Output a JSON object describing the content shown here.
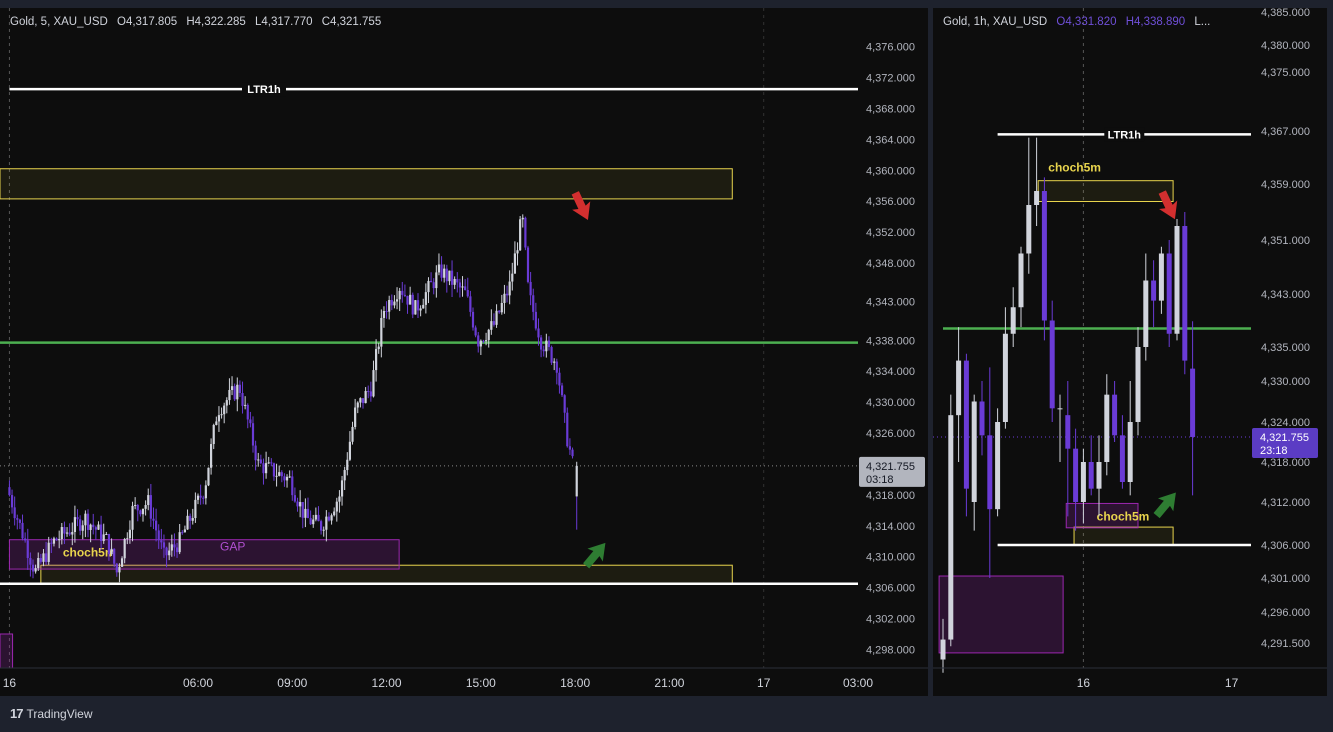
{
  "colors": {
    "background": "#0d0d0d",
    "up_candle": "#d1d4dc",
    "down_candle": "#6a3bd6",
    "level_green": "#4caf50",
    "level_white": "#ffffff",
    "zone_yellow": "#e8d44d",
    "zone_purple": "#9c27b0",
    "arrow_red": "#d32f2f",
    "arrow_green": "#2e7d32"
  },
  "footer": {
    "brand": "TradingView",
    "logo_glyph": "17"
  },
  "left_chart": {
    "legend": [
      "Gold, 5, XAU_USD",
      "O4,317.805",
      "H4,322.285",
      "L4,317.770",
      "C4,321.755"
    ],
    "price_label": "4,321.755",
    "countdown": "03:18",
    "annotations": {
      "ltr": "LTR1h",
      "choch": "choch5m",
      "gap": "GAP"
    }
  },
  "right_chart": {
    "legend": [
      "Gold, 1h, XAU_USD",
      "O4,331.820",
      "H4,338.890",
      "L..."
    ],
    "price_label": "4,321.755",
    "countdown": "23:18",
    "annotations": {
      "ltr": "LTR1h",
      "choch_top": "choch5m",
      "choch_bottom": "choch5m"
    }
  },
  "chart_data": [
    {
      "type": "candlestick",
      "title": "Gold, 5, XAU_USD",
      "ohlc_last": {
        "open": 4317.805,
        "high": 4322.285,
        "low": 4317.77,
        "close": 4321.755
      },
      "y_ticks": [
        "4,376.000",
        "4,372.000",
        "4,368.000",
        "4,364.000",
        "4,360.000",
        "4,356.000",
        "4,352.000",
        "4,348.000",
        "4,343.000",
        "4,338.000",
        "4,334.000",
        "4,330.000",
        "4,326.000",
        "4,318.000",
        "4,314.000",
        "4,310.000",
        "4,306.000",
        "4,302.000",
        "4,298.000"
      ],
      "y_tick_values": [
        4376,
        4372,
        4368,
        4364,
        4360,
        4356,
        4352,
        4348,
        4343,
        4338,
        4334,
        4330,
        4326,
        4318,
        4314,
        4310,
        4306,
        4302,
        4298
      ],
      "x_ticks": [
        "16",
        "06:00",
        "09:00",
        "12:00",
        "15:00",
        "18:00",
        "21:00",
        "17",
        "03:00"
      ],
      "x_tick_hours": [
        0,
        6,
        9,
        12,
        15,
        18,
        21,
        24,
        27
      ],
      "x_range_hours": [
        -0.3,
        27.0
      ],
      "ylim": [
        4295.6,
        4381.0
      ],
      "current_price": 4321.755,
      "levels": [
        {
          "name": "LTR1h",
          "price": 4370.5,
          "color": "white",
          "start_hour": 0
        },
        {
          "name": "",
          "price": 4337.7,
          "color": "green",
          "start_hour": -0.3
        },
        {
          "name": "",
          "price": 4306.5,
          "color": "white",
          "start_hour": -0.3
        }
      ],
      "zones": [
        {
          "label": "",
          "kind": "yellow",
          "t0": -0.3,
          "t1": 23.0,
          "p_top": 4360.2,
          "p_bot": 4356.3
        },
        {
          "label": "choch5m",
          "kind": "yellow",
          "t0": 1.0,
          "t1": 23.0,
          "p_top": 4308.9,
          "p_bot": 4306.5
        },
        {
          "label": "GAP",
          "kind": "purple",
          "t0": 0.0,
          "t1": 12.4,
          "p_top": 4312.2,
          "p_bot": 4308.4
        },
        {
          "label": "",
          "kind": "purple",
          "t0": -0.3,
          "t1": 0.1,
          "p_top": 4300.0,
          "p_bot": 4295.6
        }
      ],
      "arrows": [
        {
          "dir": "down",
          "color": "red",
          "t": 18.3,
          "p": 4354.5
        },
        {
          "dir": "up",
          "color": "green",
          "t": 18.8,
          "p": 4311.0
        }
      ],
      "path_keypoints": [
        [
          0,
          4319
        ],
        [
          0.5,
          4313
        ],
        [
          0.9,
          4308
        ],
        [
          1.5,
          4312
        ],
        [
          2.5,
          4315
        ],
        [
          3.2,
          4312
        ],
        [
          3.5,
          4308
        ],
        [
          4,
          4316
        ],
        [
          4.5,
          4317
        ],
        [
          5,
          4310
        ],
        [
          5.5,
          4312
        ],
        [
          6.3,
          4319
        ],
        [
          6.7,
          4329
        ],
        [
          7.4,
          4332
        ],
        [
          8,
          4322
        ],
        [
          9,
          4320
        ],
        [
          9.5,
          4315
        ],
        [
          10,
          4314
        ],
        [
          10.6,
          4318
        ],
        [
          11.1,
          4329
        ],
        [
          11.6,
          4332
        ],
        [
          12,
          4342
        ],
        [
          12.5,
          4345
        ],
        [
          13,
          4342
        ],
        [
          13.8,
          4347
        ],
        [
          14.6,
          4344
        ],
        [
          15,
          4338
        ],
        [
          15.5,
          4340
        ],
        [
          16,
          4345
        ],
        [
          16.4,
          4354
        ],
        [
          16.6,
          4344
        ],
        [
          17,
          4338
        ],
        [
          17.5,
          4335
        ],
        [
          17.8,
          4326
        ],
        [
          18,
          4322
        ]
      ],
      "up_color": "#d1d4dc",
      "down_color": "#6a3bd6"
    },
    {
      "type": "candlestick",
      "title": "Gold, 1h, XAU_USD",
      "ohlc_last": {
        "open": 4331.82,
        "high": 4338.89
      },
      "y_ticks": [
        "4,385.000",
        "4,380.000",
        "4,375.000",
        "4,367.000",
        "4,359.000",
        "4,351.000",
        "4,343.000",
        "4,335.000",
        "4,330.000",
        "4,324.000",
        "4,318.000",
        "4,312.000",
        "4,306.000",
        "4,301.000",
        "4,296.000",
        "4,291.500"
      ],
      "y_tick_values": [
        4385,
        4380,
        4375,
        4367,
        4359,
        4351,
        4343,
        4335,
        4330,
        4324,
        4318,
        4312,
        4306,
        4301,
        4296,
        4291.5
      ],
      "x_ticks": [
        "16",
        "17"
      ],
      "x_tick_indices": [
        18,
        37
      ],
      "current_price": 4321.755,
      "candles": [
        {
          "o": 4289,
          "h": 4295,
          "l": 4287,
          "c": 4292
        },
        {
          "o": 4292,
          "h": 4328,
          "l": 4291,
          "c": 4325
        },
        {
          "o": 4325,
          "h": 4338,
          "l": 4318,
          "c": 4333
        },
        {
          "o": 4333,
          "h": 4334,
          "l": 4310,
          "c": 4314
        },
        {
          "o": 4312,
          "h": 4328,
          "l": 4308,
          "c": 4327
        },
        {
          "o": 4327,
          "h": 4330,
          "l": 4319,
          "c": 4322
        },
        {
          "o": 4322,
          "h": 4332,
          "l": 4301,
          "c": 4311
        },
        {
          "o": 4311,
          "h": 4326,
          "l": 4310,
          "c": 4324
        },
        {
          "o": 4324,
          "h": 4341,
          "l": 4323,
          "c": 4337
        },
        {
          "o": 4337,
          "h": 4344,
          "l": 4335,
          "c": 4341
        },
        {
          "o": 4341,
          "h": 4350,
          "l": 4338,
          "c": 4349
        },
        {
          "o": 4349,
          "h": 4366,
          "l": 4346,
          "c": 4356
        },
        {
          "o": 4356,
          "h": 4366,
          "l": 4353,
          "c": 4358
        },
        {
          "o": 4358,
          "h": 4360,
          "l": 4336,
          "c": 4339
        },
        {
          "o": 4339,
          "h": 4342,
          "l": 4324,
          "c": 4326
        },
        {
          "o": 4326,
          "h": 4328,
          "l": 4318,
          "c": 4326
        },
        {
          "o": 4325,
          "h": 4330,
          "l": 4310,
          "c": 4320
        },
        {
          "o": 4320,
          "h": 4323,
          "l": 4308,
          "c": 4312
        },
        {
          "o": 4312,
          "h": 4320,
          "l": 4309,
          "c": 4318
        },
        {
          "o": 4318,
          "h": 4322,
          "l": 4313,
          "c": 4314
        },
        {
          "o": 4314,
          "h": 4322,
          "l": 4310,
          "c": 4318
        },
        {
          "o": 4318,
          "h": 4331,
          "l": 4316,
          "c": 4328
        },
        {
          "o": 4328,
          "h": 4330,
          "l": 4321,
          "c": 4322
        },
        {
          "o": 4322,
          "h": 4325,
          "l": 4314,
          "c": 4315
        },
        {
          "o": 4315,
          "h": 4330,
          "l": 4313,
          "c": 4324
        },
        {
          "o": 4324,
          "h": 4338,
          "l": 4322,
          "c": 4335
        },
        {
          "o": 4335,
          "h": 4349,
          "l": 4333,
          "c": 4345
        },
        {
          "o": 4345,
          "h": 4348,
          "l": 4338,
          "c": 4342
        },
        {
          "o": 4342,
          "h": 4350,
          "l": 4340,
          "c": 4349
        },
        {
          "o": 4349,
          "h": 4351,
          "l": 4335,
          "c": 4337
        },
        {
          "o": 4337,
          "h": 4354,
          "l": 4336,
          "c": 4353
        },
        {
          "o": 4353,
          "h": 4355,
          "l": 4331,
          "c": 4333
        },
        {
          "o": 4331.82,
          "h": 4338.89,
          "l": 4313,
          "c": 4321.755
        }
      ],
      "levels": [
        {
          "name": "LTR1h",
          "price": 4366.5,
          "color": "white",
          "from_index": 7
        },
        {
          "name": "",
          "price": 4337.8,
          "color": "green",
          "from_index": 0
        },
        {
          "name": "",
          "price": 4306.0,
          "color": "white",
          "from_index": 7
        }
      ],
      "zones": [
        {
          "label": "choch5m",
          "kind": "yellow",
          "i0": 12.2,
          "i1": 29.5,
          "p_top": 4359.5,
          "p_bot": 4356.5
        },
        {
          "label": "choch5m",
          "kind": "yellow",
          "i0": 16.8,
          "i1": 29.5,
          "p_top": 4308.5,
          "p_bot": 4306.0
        },
        {
          "label": "",
          "kind": "purple",
          "i0": 15.8,
          "i1": 25.0,
          "p_top": 4311.8,
          "p_bot": 4308.4
        },
        {
          "label": "",
          "kind": "purple",
          "i0": -0.5,
          "i1": 15.4,
          "p_top": 4301.3,
          "p_bot": 4290.0
        }
      ],
      "arrows": [
        {
          "dir": "down",
          "color": "red",
          "i": 29.3,
          "p": 4355.0
        },
        {
          "dir": "up",
          "color": "green",
          "i": 29.2,
          "p": 4312.5
        }
      ],
      "up_color": "#d1d4dc",
      "down_color": "#6a3bd6"
    }
  ]
}
